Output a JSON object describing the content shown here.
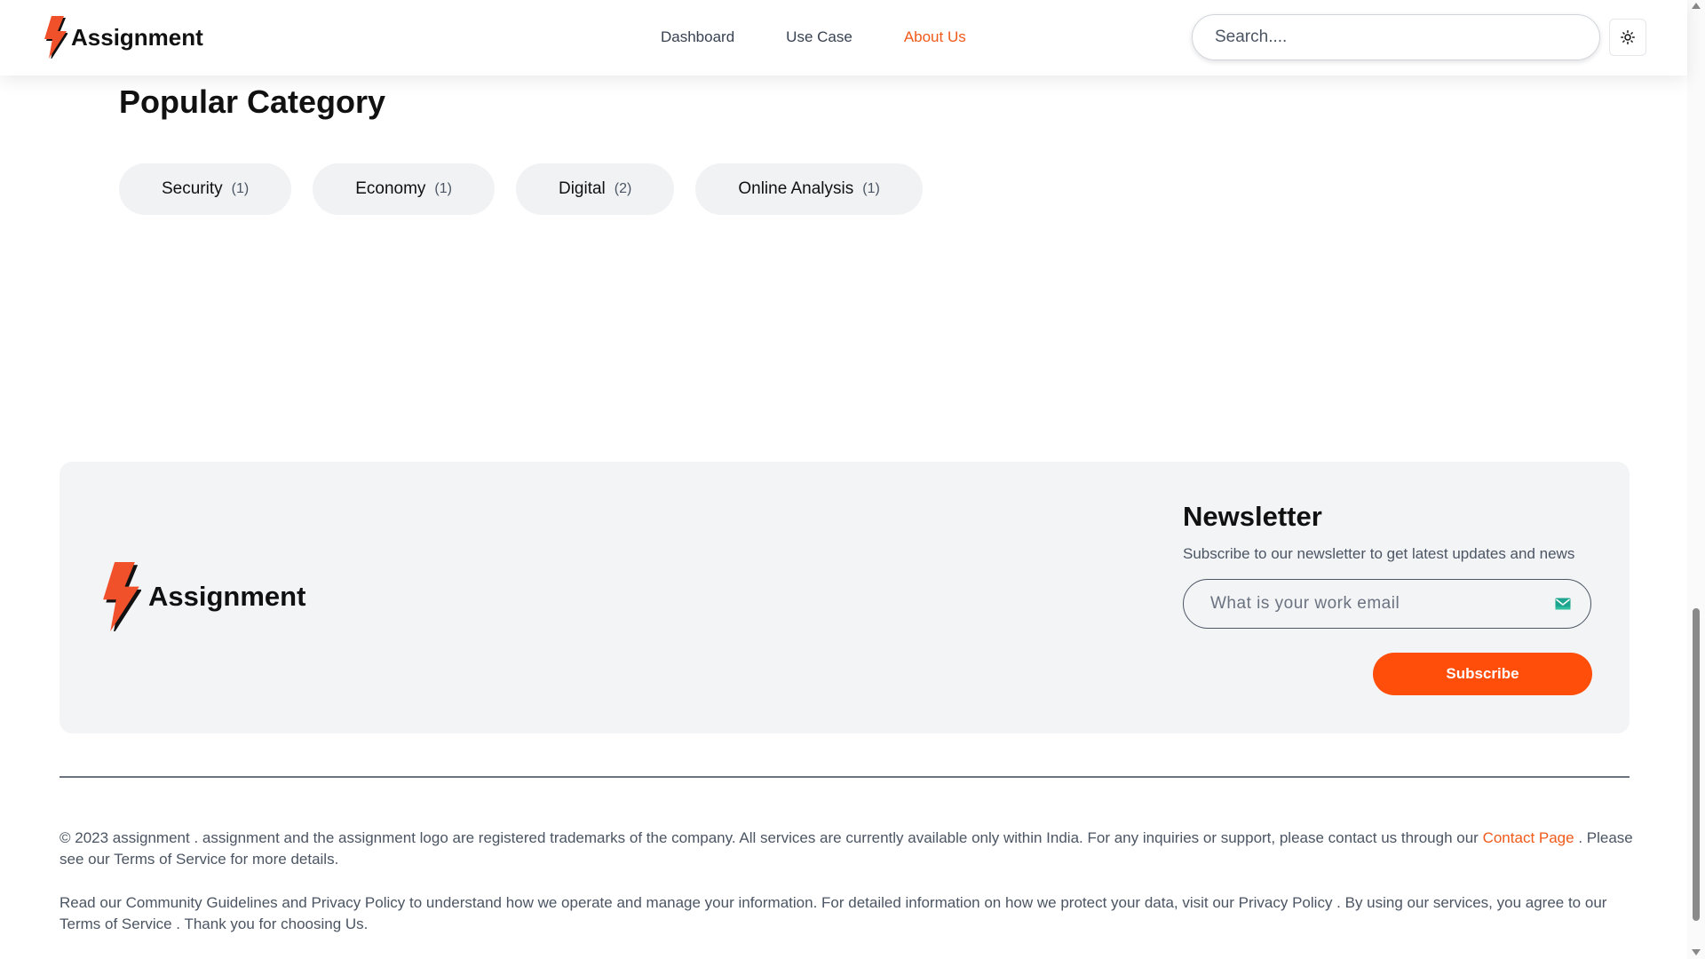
{
  "header": {
    "brand": "Assignment",
    "nav": [
      {
        "label": "Dashboard",
        "active": false
      },
      {
        "label": "Use Case",
        "active": false
      },
      {
        "label": "About Us",
        "active": true
      }
    ],
    "search_placeholder": "Search....",
    "theme_icon": "sun-icon"
  },
  "popular": {
    "title": "Popular Category",
    "categories": [
      {
        "label": "Security",
        "count": "(1)"
      },
      {
        "label": "Economy",
        "count": "(1)"
      },
      {
        "label": "Digital",
        "count": "(2)"
      },
      {
        "label": "Online Analysis",
        "count": "(1)"
      }
    ]
  },
  "footer": {
    "brand": "Assignment",
    "newsletter": {
      "title": "Newsletter",
      "subtitle": "Subscribe to our newsletter to get latest updates and news",
      "email_placeholder": "What is your work email",
      "button": "Subscribe"
    },
    "legal1_a": "© 2023 assignment . assignment and the assignment logo are registered trademarks of the company. All services are currently available only within India. For any inquiries or support, please contact us through our",
    "legal1_link": "Contact Page",
    "legal1_b": ". Please see our Terms of Service for more details.",
    "legal2": "Read our Community Guidelines and Privacy Policy to understand how we operate and manage your information. For detailed information on how we protect your data, visit our Privacy Policy . By using our services, you agree to our Terms of Service . Thank you for choosing Us."
  },
  "colors": {
    "accent": "#ff4d0a",
    "active_nav": "#f05a1a",
    "card_bg": "#f3f4f6"
  }
}
